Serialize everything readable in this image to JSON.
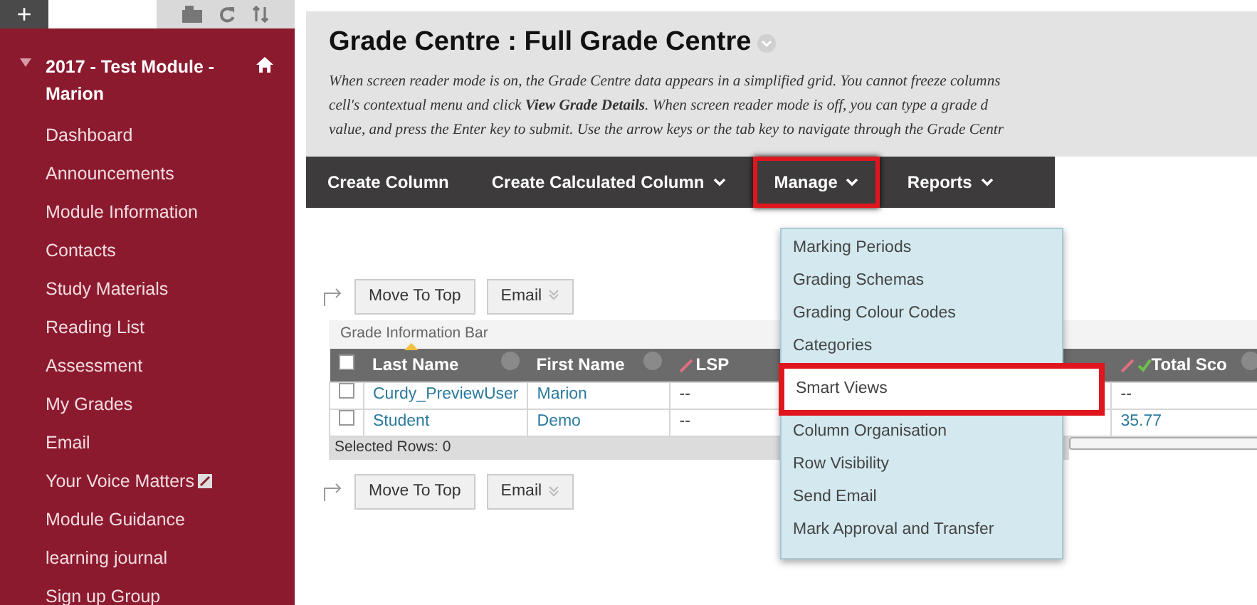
{
  "sidebar": {
    "toolbar": {
      "add": "+"
    },
    "course_title": "2017 - Test Module - Marion",
    "items": [
      {
        "label": "Dashboard",
        "kind": "link"
      },
      {
        "label": "Announcements",
        "kind": "link"
      },
      {
        "label": "Module Information",
        "kind": "link"
      },
      {
        "label": "Contacts",
        "kind": "link"
      },
      {
        "label": "Study Materials",
        "kind": "link"
      },
      {
        "label": "Reading List",
        "kind": "link"
      },
      {
        "label": "Assessment",
        "kind": "link"
      },
      {
        "label": "My Grades",
        "kind": "link"
      },
      {
        "label": "Email",
        "kind": "link"
      },
      {
        "label": "Your Voice Matters",
        "kind": "external"
      },
      {
        "label": "Module Guidance",
        "kind": "link"
      },
      {
        "label": "learning journal",
        "kind": "link"
      },
      {
        "label": "Sign up Group",
        "kind": "link"
      }
    ]
  },
  "page_title": "Grade Centre : Full Grade Centre",
  "description": [
    "When screen reader mode is on, the Grade Centre data appears in a simplified grid. You cannot freeze columns",
    "cell's contextual menu and click **View Grade Details**. When screen reader mode is off, you can type a grade d",
    "value, and press the Enter key to submit. Use the arrow keys or the tab key to navigate through the Grade Centr"
  ],
  "action_bar": [
    {
      "label": "Create Column",
      "caret": false,
      "highlighted": false
    },
    {
      "label": "Create Calculated Column",
      "caret": true,
      "highlighted": false
    },
    {
      "label": "Manage",
      "caret": true,
      "highlighted": true
    },
    {
      "label": "Reports",
      "caret": true,
      "highlighted": false
    }
  ],
  "manage_menu": [
    {
      "label": "Marking Periods",
      "highlighted": false
    },
    {
      "label": "Grading Schemas",
      "highlighted": false
    },
    {
      "label": "Grading Colour Codes",
      "highlighted": false
    },
    {
      "label": "Categories",
      "highlighted": false
    },
    {
      "label": "Smart Views",
      "highlighted": true
    },
    {
      "label": "Column Organisation",
      "highlighted": false
    },
    {
      "label": "Row Visibility",
      "highlighted": false
    },
    {
      "label": "Send Email",
      "highlighted": false
    },
    {
      "label": "Mark Approval and Transfer",
      "highlighted": false
    }
  ],
  "top_buttons": [
    "Move To Top",
    "Email"
  ],
  "grade_information_bar": "Grade Information Bar",
  "table": {
    "select_all_checked": false,
    "columns": [
      {
        "label": "Last Name",
        "kind": "sorted"
      },
      {
        "label": "First Name",
        "kind": "plain"
      },
      {
        "label": "LSP",
        "kind": "slash"
      },
      {
        "label": "Total Sco",
        "kind": "total"
      }
    ],
    "rows": [
      {
        "cells": [
          "Curdy_PreviewUser",
          "Marion",
          "--",
          "--"
        ],
        "checked": false
      },
      {
        "cells": [
          "Student",
          "Demo",
          "--",
          "35.77"
        ],
        "checked": false
      }
    ]
  },
  "selected_rows": "Selected Rows: 0",
  "bottom_buttons": [
    "Move To Top",
    "Email"
  ]
}
